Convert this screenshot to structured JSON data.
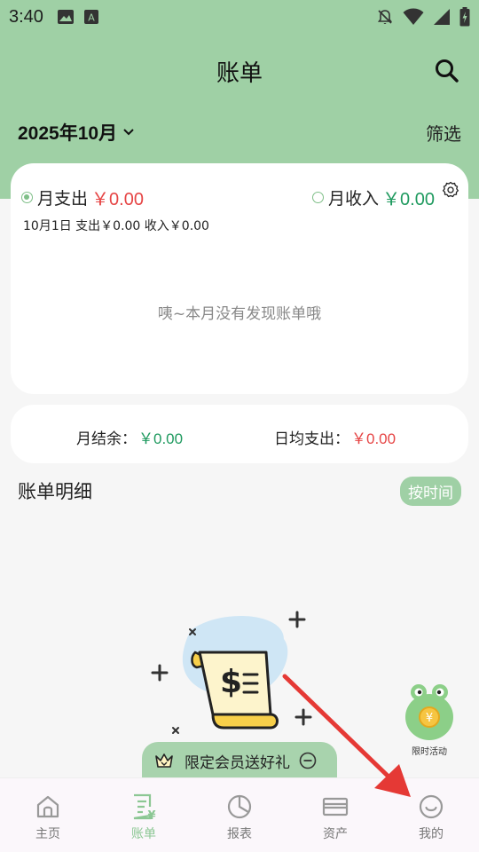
{
  "status_bar": {
    "time": "3:40",
    "left_icons": [
      "image-icon",
      "a-icon"
    ],
    "right_icons": [
      "notification-off-icon",
      "wifi-icon",
      "signal-icon",
      "battery-charging-icon"
    ]
  },
  "header": {
    "title": "账单",
    "month": "2025年10月",
    "filter_label": "筛选"
  },
  "summary_card": {
    "expense_label": "月支出",
    "expense_amount": "￥0.00",
    "income_label": "月收入",
    "income_amount": "￥0.00",
    "day_summary": "10月1日  支出￥0.00  收入￥0.00",
    "empty_text": "咦~本月没有发现账单哦"
  },
  "balance_card": {
    "balance_label": "月结余：",
    "balance_amount": "￥0.00",
    "daily_label": "日均支出：",
    "daily_amount": "￥0.00"
  },
  "detail": {
    "title": "账单明细",
    "sort_label": "按时间"
  },
  "promo": {
    "float_label": "限时活动",
    "vip_text": "限定会员送好礼"
  },
  "bottom_nav": {
    "items": [
      {
        "label": "主页",
        "icon": "home-icon"
      },
      {
        "label": "账单",
        "icon": "bill-icon"
      },
      {
        "label": "报表",
        "icon": "pie-chart-icon"
      },
      {
        "label": "资产",
        "icon": "card-icon"
      },
      {
        "label": "我的",
        "icon": "smile-icon"
      }
    ],
    "active_index": 1
  },
  "colors": {
    "brand_green": "#9fd0a5",
    "expense_red": "#e64545",
    "income_green": "#1f9a5f",
    "arrow_red": "#e53935"
  }
}
